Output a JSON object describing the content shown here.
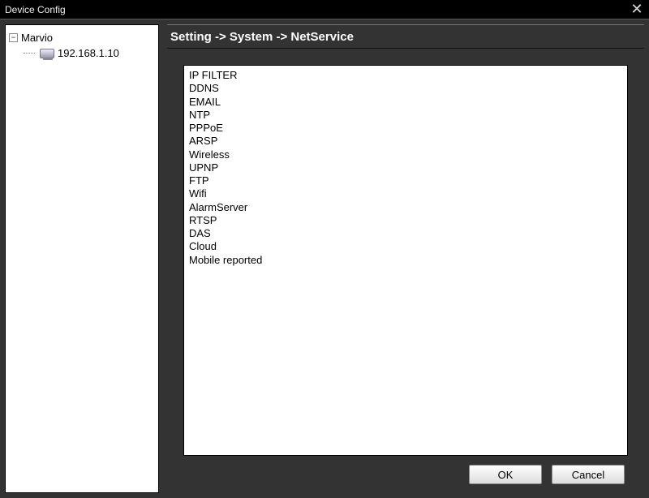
{
  "window": {
    "title": "Device Config"
  },
  "sidebar": {
    "root": {
      "label": "Marvio",
      "expanded": true
    },
    "children": [
      {
        "label": "192.168.1.10"
      }
    ]
  },
  "breadcrumb": {
    "text": "Setting -> System -> NetService"
  },
  "netservice": {
    "items": [
      "IP FILTER",
      "DDNS",
      "EMAIL",
      "NTP",
      "PPPoE",
      "ARSP",
      "Wireless",
      "UPNP",
      "FTP",
      "Wifi",
      "AlarmServer",
      "RTSP",
      "DAS",
      "Cloud",
      "Mobile reported"
    ]
  },
  "buttons": {
    "ok": "OK",
    "cancel": "Cancel"
  }
}
